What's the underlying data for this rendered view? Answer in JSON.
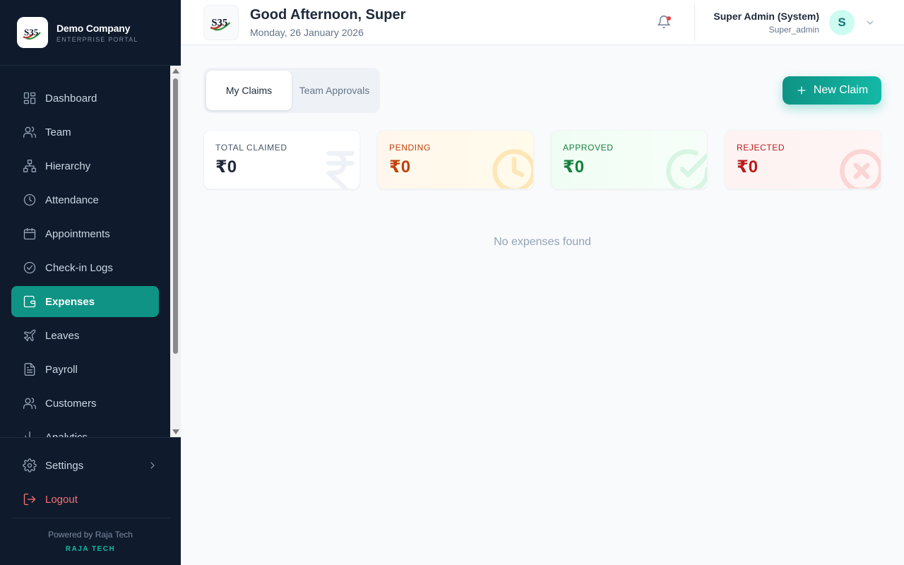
{
  "brand": {
    "name": "Demo Company",
    "subtitle": "ENTERPRISE PORTAL",
    "logo_text": "S35"
  },
  "sidebar": {
    "items": [
      {
        "label": "Dashboard",
        "icon": "dashboard-grid-icon"
      },
      {
        "label": "Team",
        "icon": "users-icon"
      },
      {
        "label": "Hierarchy",
        "icon": "hierarchy-icon"
      },
      {
        "label": "Attendance",
        "icon": "clock-icon"
      },
      {
        "label": "Appointments",
        "icon": "calendar-icon"
      },
      {
        "label": "Check-in Logs",
        "icon": "check-circle-icon"
      },
      {
        "label": "Expenses",
        "icon": "wallet-icon",
        "active": true
      },
      {
        "label": "Leaves",
        "icon": "plane-icon"
      },
      {
        "label": "Payroll",
        "icon": "document-icon"
      },
      {
        "label": "Customers",
        "icon": "users-icon"
      },
      {
        "label": "Analytics",
        "icon": "chart-icon"
      }
    ],
    "settings_label": "Settings",
    "logout_label": "Logout",
    "powered_by": "Powered by Raja Tech",
    "company_tag": "RAJA TECH"
  },
  "header": {
    "greeting": "Good Afternoon, Super",
    "date": "Monday, 26 January 2026",
    "user_name": "Super Admin (System)",
    "user_role": "Super_admin",
    "avatar_initial": "S"
  },
  "tabs": {
    "my_claims": "My Claims",
    "team_approvals": "Team Approvals"
  },
  "new_claim_label": "New Claim",
  "summary": {
    "total": {
      "label": "TOTAL CLAIMED",
      "value": "₹0"
    },
    "pending": {
      "label": "PENDING",
      "value": "₹0"
    },
    "approved": {
      "label": "APPROVED",
      "value": "₹0"
    },
    "rejected": {
      "label": "REJECTED",
      "value": "₹0"
    }
  },
  "empty_message": "No expenses found",
  "colors": {
    "sidebar_bg": "#0f1b2d",
    "accent": "#0e9384",
    "danger": "#f87171"
  }
}
